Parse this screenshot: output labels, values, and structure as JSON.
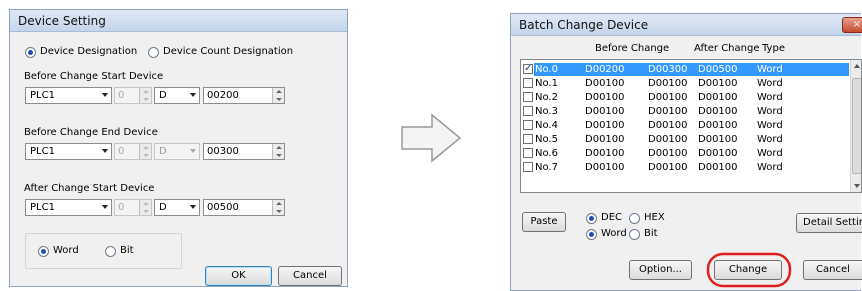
{
  "device_setting": {
    "title": "Device Setting",
    "mode_options": {
      "device_designation": "Device Designation",
      "device_count_designation": "Device Count Designation"
    },
    "before_start": {
      "label": "Before Change Start Device",
      "plc": "PLC1",
      "number": "0",
      "device_type": "D",
      "address": "00200"
    },
    "before_end": {
      "label": "Before Change End Device",
      "plc": "PLC1",
      "number": "0",
      "device_type": "D",
      "address": "00300"
    },
    "after_start": {
      "label": "After Change Start Device",
      "plc": "PLC1",
      "number": "0",
      "device_type": "D",
      "address": "00500"
    },
    "unit_options": {
      "word": "Word",
      "bit": "Bit"
    },
    "ok_label": "OK",
    "cancel_label": "Cancel"
  },
  "batch_change": {
    "title": "Batch Change Device",
    "close_label": "×",
    "headers": {
      "before": "Before Change",
      "after": "After Change",
      "type": "Type"
    },
    "rows": [
      {
        "no": "No.0",
        "b1": "D00200",
        "b2": "D00300",
        "after": "D00500",
        "type": "Word"
      },
      {
        "no": "No.1",
        "b1": "D00100",
        "b2": "D00100",
        "after": "D00100",
        "type": "Word"
      },
      {
        "no": "No.2",
        "b1": "D00100",
        "b2": "D00100",
        "after": "D00100",
        "type": "Word"
      },
      {
        "no": "No.3",
        "b1": "D00100",
        "b2": "D00100",
        "after": "D00100",
        "type": "Word"
      },
      {
        "no": "No.4",
        "b1": "D00100",
        "b2": "D00100",
        "after": "D00100",
        "type": "Word"
      },
      {
        "no": "No.5",
        "b1": "D00100",
        "b2": "D00100",
        "after": "D00100",
        "type": "Word"
      },
      {
        "no": "No.6",
        "b1": "D00100",
        "b2": "D00100",
        "after": "D00100",
        "type": "Word"
      },
      {
        "no": "No.7",
        "b1": "D00100",
        "b2": "D00100",
        "after": "D00100",
        "type": "Word"
      }
    ],
    "paste_label": "Paste",
    "radix_options": {
      "dec": "DEC",
      "hex": "HEX"
    },
    "unit_options": {
      "word": "Word",
      "bit": "Bit"
    },
    "detail_settings_label": "Detail Settings",
    "option_label": "Option...",
    "change_label": "Change",
    "cancel_label": "Cancel"
  },
  "colors": {
    "highlight_ring": "#e02020",
    "selection": "#3399ff"
  }
}
